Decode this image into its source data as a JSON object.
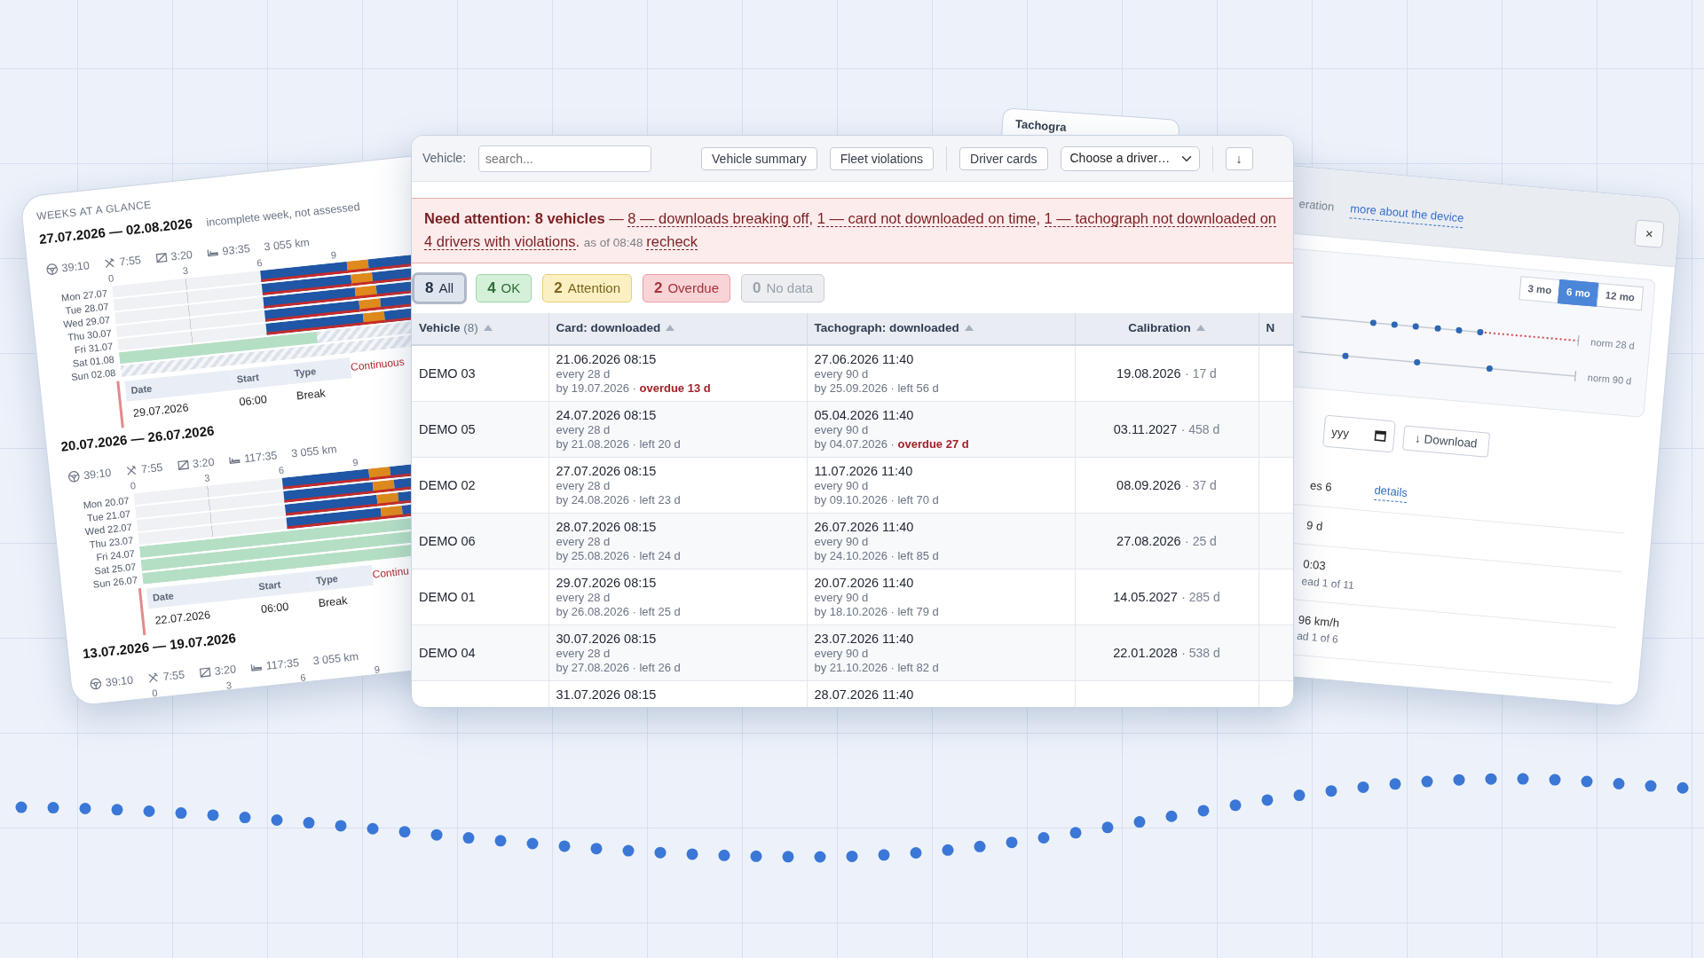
{
  "weeks_panel": {
    "heading": "WEEKS AT A GLANCE",
    "weeks": [
      {
        "range": "27.07.2026 — 02.08.2026",
        "note": "incomplete week, not assessed",
        "stats": [
          {
            "kind": "driving",
            "value": "39:10"
          },
          {
            "kind": "work",
            "value": "7:55"
          },
          {
            "kind": "available",
            "value": "3:20"
          },
          {
            "kind": "rest",
            "value": "93:35"
          },
          {
            "kind": "distance",
            "value": "3 055 km"
          }
        ],
        "ticks": [
          "0",
          "3",
          "6",
          "9"
        ],
        "days": [
          {
            "label": "Mon 27.07",
            "kind": "work"
          },
          {
            "label": "Tue 28.07",
            "kind": "work"
          },
          {
            "label": "Wed 29.07",
            "kind": "work"
          },
          {
            "label": "Thu 30.07",
            "kind": "work"
          },
          {
            "label": "Fri 31.07",
            "kind": "work"
          },
          {
            "label": "Sat 01.08",
            "kind": "rest_partial"
          },
          {
            "label": "Sun 02.08",
            "kind": "no_data"
          }
        ],
        "violation": {
          "columns": [
            "Date",
            "Start",
            "Type"
          ],
          "date": "29.07.2026",
          "start": "06:00",
          "type": "Break",
          "note": "Continuous"
        }
      },
      {
        "range": "20.07.2026 — 26.07.2026",
        "stats": [
          {
            "kind": "driving",
            "value": "39:10"
          },
          {
            "kind": "work",
            "value": "7:55"
          },
          {
            "kind": "available",
            "value": "3:20"
          },
          {
            "kind": "rest",
            "value": "117:35"
          },
          {
            "kind": "distance",
            "value": "3 055 km"
          }
        ],
        "ticks": [
          "0",
          "3",
          "6",
          "9"
        ],
        "days": [
          {
            "label": "Mon 20.07",
            "kind": "work"
          },
          {
            "label": "Tue 21.07",
            "kind": "work"
          },
          {
            "label": "Wed 22.07",
            "kind": "work"
          },
          {
            "label": "Thu 23.07",
            "kind": "work"
          },
          {
            "label": "Fri 24.07",
            "kind": "rest"
          },
          {
            "label": "Sat 25.07",
            "kind": "rest"
          },
          {
            "label": "Sun 26.07",
            "kind": "rest"
          }
        ],
        "violation": {
          "columns": [
            "Date",
            "Start",
            "Type"
          ],
          "date": "22.07.2026",
          "start": "06:00",
          "type": "Break",
          "note": "Continu"
        }
      },
      {
        "range": "13.07.2026 — 19.07.2026",
        "stats": [
          {
            "kind": "driving",
            "value": "39:10"
          },
          {
            "kind": "work",
            "value": "7:55"
          },
          {
            "kind": "available",
            "value": "3:20"
          },
          {
            "kind": "rest",
            "value": "117:35"
          },
          {
            "kind": "distance",
            "value": "3 055 km"
          }
        ],
        "ticks": [
          "0",
          "3",
          "6",
          "9"
        ]
      }
    ]
  },
  "back_tab": {
    "title": "Tachogra"
  },
  "fleet": {
    "toolbar": {
      "vehicle_label": "Vehicle:",
      "search": {
        "placeholder": "search..."
      },
      "buttons": [
        "Vehicle summary",
        "Fleet violations"
      ],
      "driver_button": "Driver cards",
      "driver_select": "Choose a driver…",
      "download_button": "↓"
    },
    "alert": {
      "lines": [
        [
          {
            "kind": "bold",
            "text": "Need attention: 8 vehicles"
          },
          {
            "kind": "plain",
            "text": " — "
          },
          {
            "kind": "link",
            "text": "8 — downloads breaking off"
          },
          {
            "kind": "plain",
            "text": ", "
          },
          {
            "kind": "link",
            "text": "1 — card not downloaded on time"
          },
          {
            "kind": "plain",
            "text": ", "
          },
          {
            "kind": "link",
            "text": "1 — tachograph not downloaded on"
          }
        ],
        [
          {
            "kind": "link",
            "text": "4 drivers with violations"
          },
          {
            "kind": "plain",
            "text": ". "
          },
          {
            "kind": "muted",
            "text": "as of 08:48 "
          },
          {
            "kind": "action",
            "text": "recheck"
          }
        ]
      ]
    },
    "filters": [
      {
        "count": "8",
        "label": "All",
        "kind": "all",
        "selected": true
      },
      {
        "count": "4",
        "label": "OK",
        "kind": "ok",
        "selected": false
      },
      {
        "count": "2",
        "label": "Attention",
        "kind": "attention",
        "selected": false
      },
      {
        "count": "2",
        "label": "Overdue",
        "kind": "overdue",
        "selected": false
      },
      {
        "count": "0",
        "label": "No data",
        "kind": "nodata",
        "selected": false
      }
    ],
    "table": {
      "columns": [
        {
          "label": "Vehicle",
          "count": "(8)",
          "sortable": true
        },
        {
          "label": "Card: downloaded",
          "sortable": true
        },
        {
          "label": "Tachograph: downloaded",
          "sortable": true
        },
        {
          "label": "Calibration",
          "sortable": true
        },
        {
          "label": "N",
          "sortable": false
        }
      ],
      "rows": [
        {
          "vehicle": "DEMO 03",
          "card": {
            "date": "21.06.2026 08:15",
            "interval": "every 28 d",
            "due": "by 19.07.2026 ·",
            "status": "overdue 13 d",
            "overdue": true
          },
          "tachograph": {
            "date": "27.06.2026 11:40",
            "interval": "every 90 d",
            "due": "by 25.09.2026 ·",
            "status": "left 56 d",
            "overdue": false
          },
          "calibration": {
            "date": "19.08.2026",
            "days": "· 17 d"
          }
        },
        {
          "vehicle": "DEMO 05",
          "card": {
            "date": "24.07.2026 08:15",
            "interval": "every 28 d",
            "due": "by 21.08.2026 ·",
            "status": "left 20 d",
            "overdue": false
          },
          "tachograph": {
            "date": "05.04.2026 11:40",
            "interval": "every 90 d",
            "due": "by 04.07.2026 ·",
            "status": "overdue 27 d",
            "overdue": true
          },
          "calibration": {
            "date": "03.11.2027",
            "days": "· 458 d"
          }
        },
        {
          "vehicle": "DEMO 02",
          "card": {
            "date": "27.07.2026 08:15",
            "interval": "every 28 d",
            "due": "by 24.08.2026 ·",
            "status": "left 23 d",
            "overdue": false
          },
          "tachograph": {
            "date": "11.07.2026 11:40",
            "interval": "every 90 d",
            "due": "by 09.10.2026 ·",
            "status": "left 70 d",
            "overdue": false
          },
          "calibration": {
            "date": "08.09.2026",
            "days": "· 37 d"
          }
        },
        {
          "vehicle": "DEMO 06",
          "card": {
            "date": "28.07.2026 08:15",
            "interval": "every 28 d",
            "due": "by 25.08.2026 ·",
            "status": "left 24 d",
            "overdue": false
          },
          "tachograph": {
            "date": "26.07.2026 11:40",
            "interval": "every 90 d",
            "due": "by 24.10.2026 ·",
            "status": "left 85 d",
            "overdue": false
          },
          "calibration": {
            "date": "27.08.2026",
            "days": "· 25 d"
          }
        },
        {
          "vehicle": "DEMO 01",
          "card": {
            "date": "29.07.2026 08:15",
            "interval": "every 28 d",
            "due": "by 26.08.2026 ·",
            "status": "left 25 d",
            "overdue": false
          },
          "tachograph": {
            "date": "20.07.2026 11:40",
            "interval": "every 90 d",
            "due": "by 18.10.2026 ·",
            "status": "left 79 d",
            "overdue": false
          },
          "calibration": {
            "date": "14.05.2027",
            "days": "· 285 d"
          }
        },
        {
          "vehicle": "DEMO 04",
          "card": {
            "date": "30.07.2026 08:15",
            "interval": "every 28 d",
            "due": "by 27.08.2026 ·",
            "status": "left 26 d",
            "overdue": false
          },
          "tachograph": {
            "date": "23.07.2026 11:40",
            "interval": "every 90 d",
            "due": "by 21.10.2026 ·",
            "status": "left 82 d",
            "overdue": false
          },
          "calibration": {
            "date": "22.01.2028",
            "days": "· 538 d"
          }
        }
      ],
      "partial_row": {
        "card": "31.07.2026 08:15",
        "tachograph": "28.07.2026 11:40"
      }
    }
  },
  "device_panel": {
    "header": {
      "title": "eration",
      "link": "more about the device",
      "close": "×"
    },
    "periods": [
      {
        "label": "3 mo",
        "selected": false
      },
      {
        "label": "6 mo",
        "selected": true
      },
      {
        "label": "12 mo",
        "selected": false
      }
    ],
    "timelines": [
      {
        "norm": "norm 28 d",
        "overdue": true
      },
      {
        "norm": "norm 90 d",
        "overdue": false
      }
    ],
    "date_field": {
      "placeholder": "yyy"
    },
    "download": "↓ Download",
    "rows": [
      {
        "text": "es 6",
        "link": "details"
      },
      {
        "text": "9 d"
      },
      {
        "text": "0:03",
        "sub": "ead 1 of 11"
      },
      {
        "text": "96 km/h",
        "sub": "ad 1 of 6"
      }
    ]
  }
}
